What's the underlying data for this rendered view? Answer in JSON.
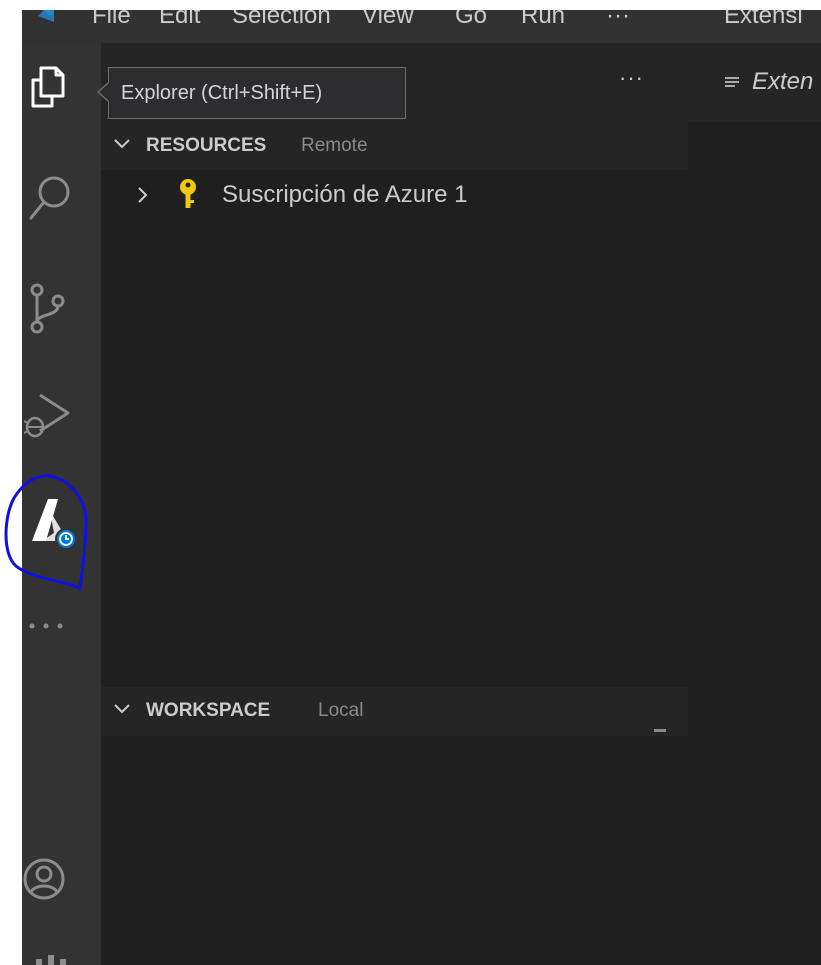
{
  "menubar": {
    "items": [
      "File",
      "Edit",
      "Selection",
      "View",
      "Go",
      "Run",
      "···",
      "Extensi"
    ]
  },
  "activity_bar": {
    "icons": [
      "files-icon",
      "search-icon",
      "source-control-icon",
      "run-debug-icon",
      "azure-icon",
      "more-icon",
      "account-icon",
      "settings-icon"
    ]
  },
  "tooltip": {
    "text": "Explorer (Ctrl+Shift+E)"
  },
  "sidebar": {
    "more_actions": "···",
    "resources": {
      "title": "RESOURCES",
      "description": "Remote",
      "items": [
        {
          "label": "Suscripción de Azure 1"
        }
      ]
    },
    "workspace": {
      "title": "WORKSPACE",
      "description": "Local"
    }
  },
  "editor": {
    "tab_label": "Exten"
  },
  "colors": {
    "activity_bar": "#333333",
    "sidebar": "#252526",
    "section_body": "#1f1f1f",
    "key_icon": "#f2c811",
    "azure_badge": "#0078d4",
    "annotation_stroke": "#1010e0"
  }
}
